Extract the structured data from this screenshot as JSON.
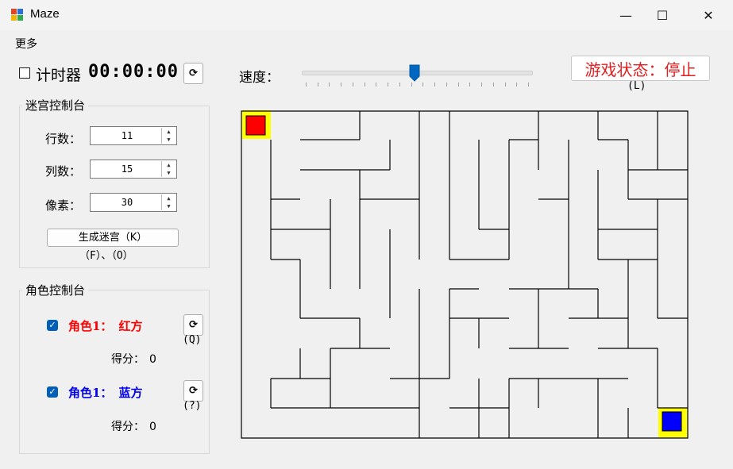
{
  "window": {
    "title": "Maze",
    "controls": {
      "minimize": "—",
      "maximize": "☐",
      "close": "✕"
    }
  },
  "menu": {
    "more": "更多"
  },
  "timer": {
    "label": "计时器",
    "value": "00:00:00",
    "checked": false,
    "reset_icon": "refresh-icon"
  },
  "speed": {
    "label": "速度：",
    "level": 0.49,
    "ticks": 20
  },
  "status": {
    "text": "游戏状态：停止",
    "hint": "(L)",
    "color": "#e21f1f"
  },
  "maze_console": {
    "title": "迷宫控制台",
    "rows_label": "行数：",
    "rows": "11",
    "cols_label": "列数：",
    "cols": "15",
    "pixel_label": "像素：",
    "pixel": "30",
    "generate_button": "生成迷宫（K）",
    "generate_hint": "（F）、（O）"
  },
  "role_console": {
    "title": "角色控制台",
    "role1": {
      "label": "角色1：",
      "team": "红方",
      "color": "#ff0000",
      "checked": true,
      "hint": "(Q)",
      "score_label": "得分：",
      "score": "0"
    },
    "role2": {
      "label": "角色1：",
      "team": "蓝方",
      "color": "#0000ee",
      "checked": true,
      "hint": "(?)",
      "score_label": "得分：",
      "score": "0"
    }
  },
  "maze": {
    "rows": 11,
    "cols": 15,
    "player_red": {
      "row": 0,
      "col": 0,
      "color": "#ff0000"
    },
    "player_blue": {
      "row": 10,
      "col": 14,
      "color": "#0000ff"
    },
    "highlight": "#ffff00"
  }
}
